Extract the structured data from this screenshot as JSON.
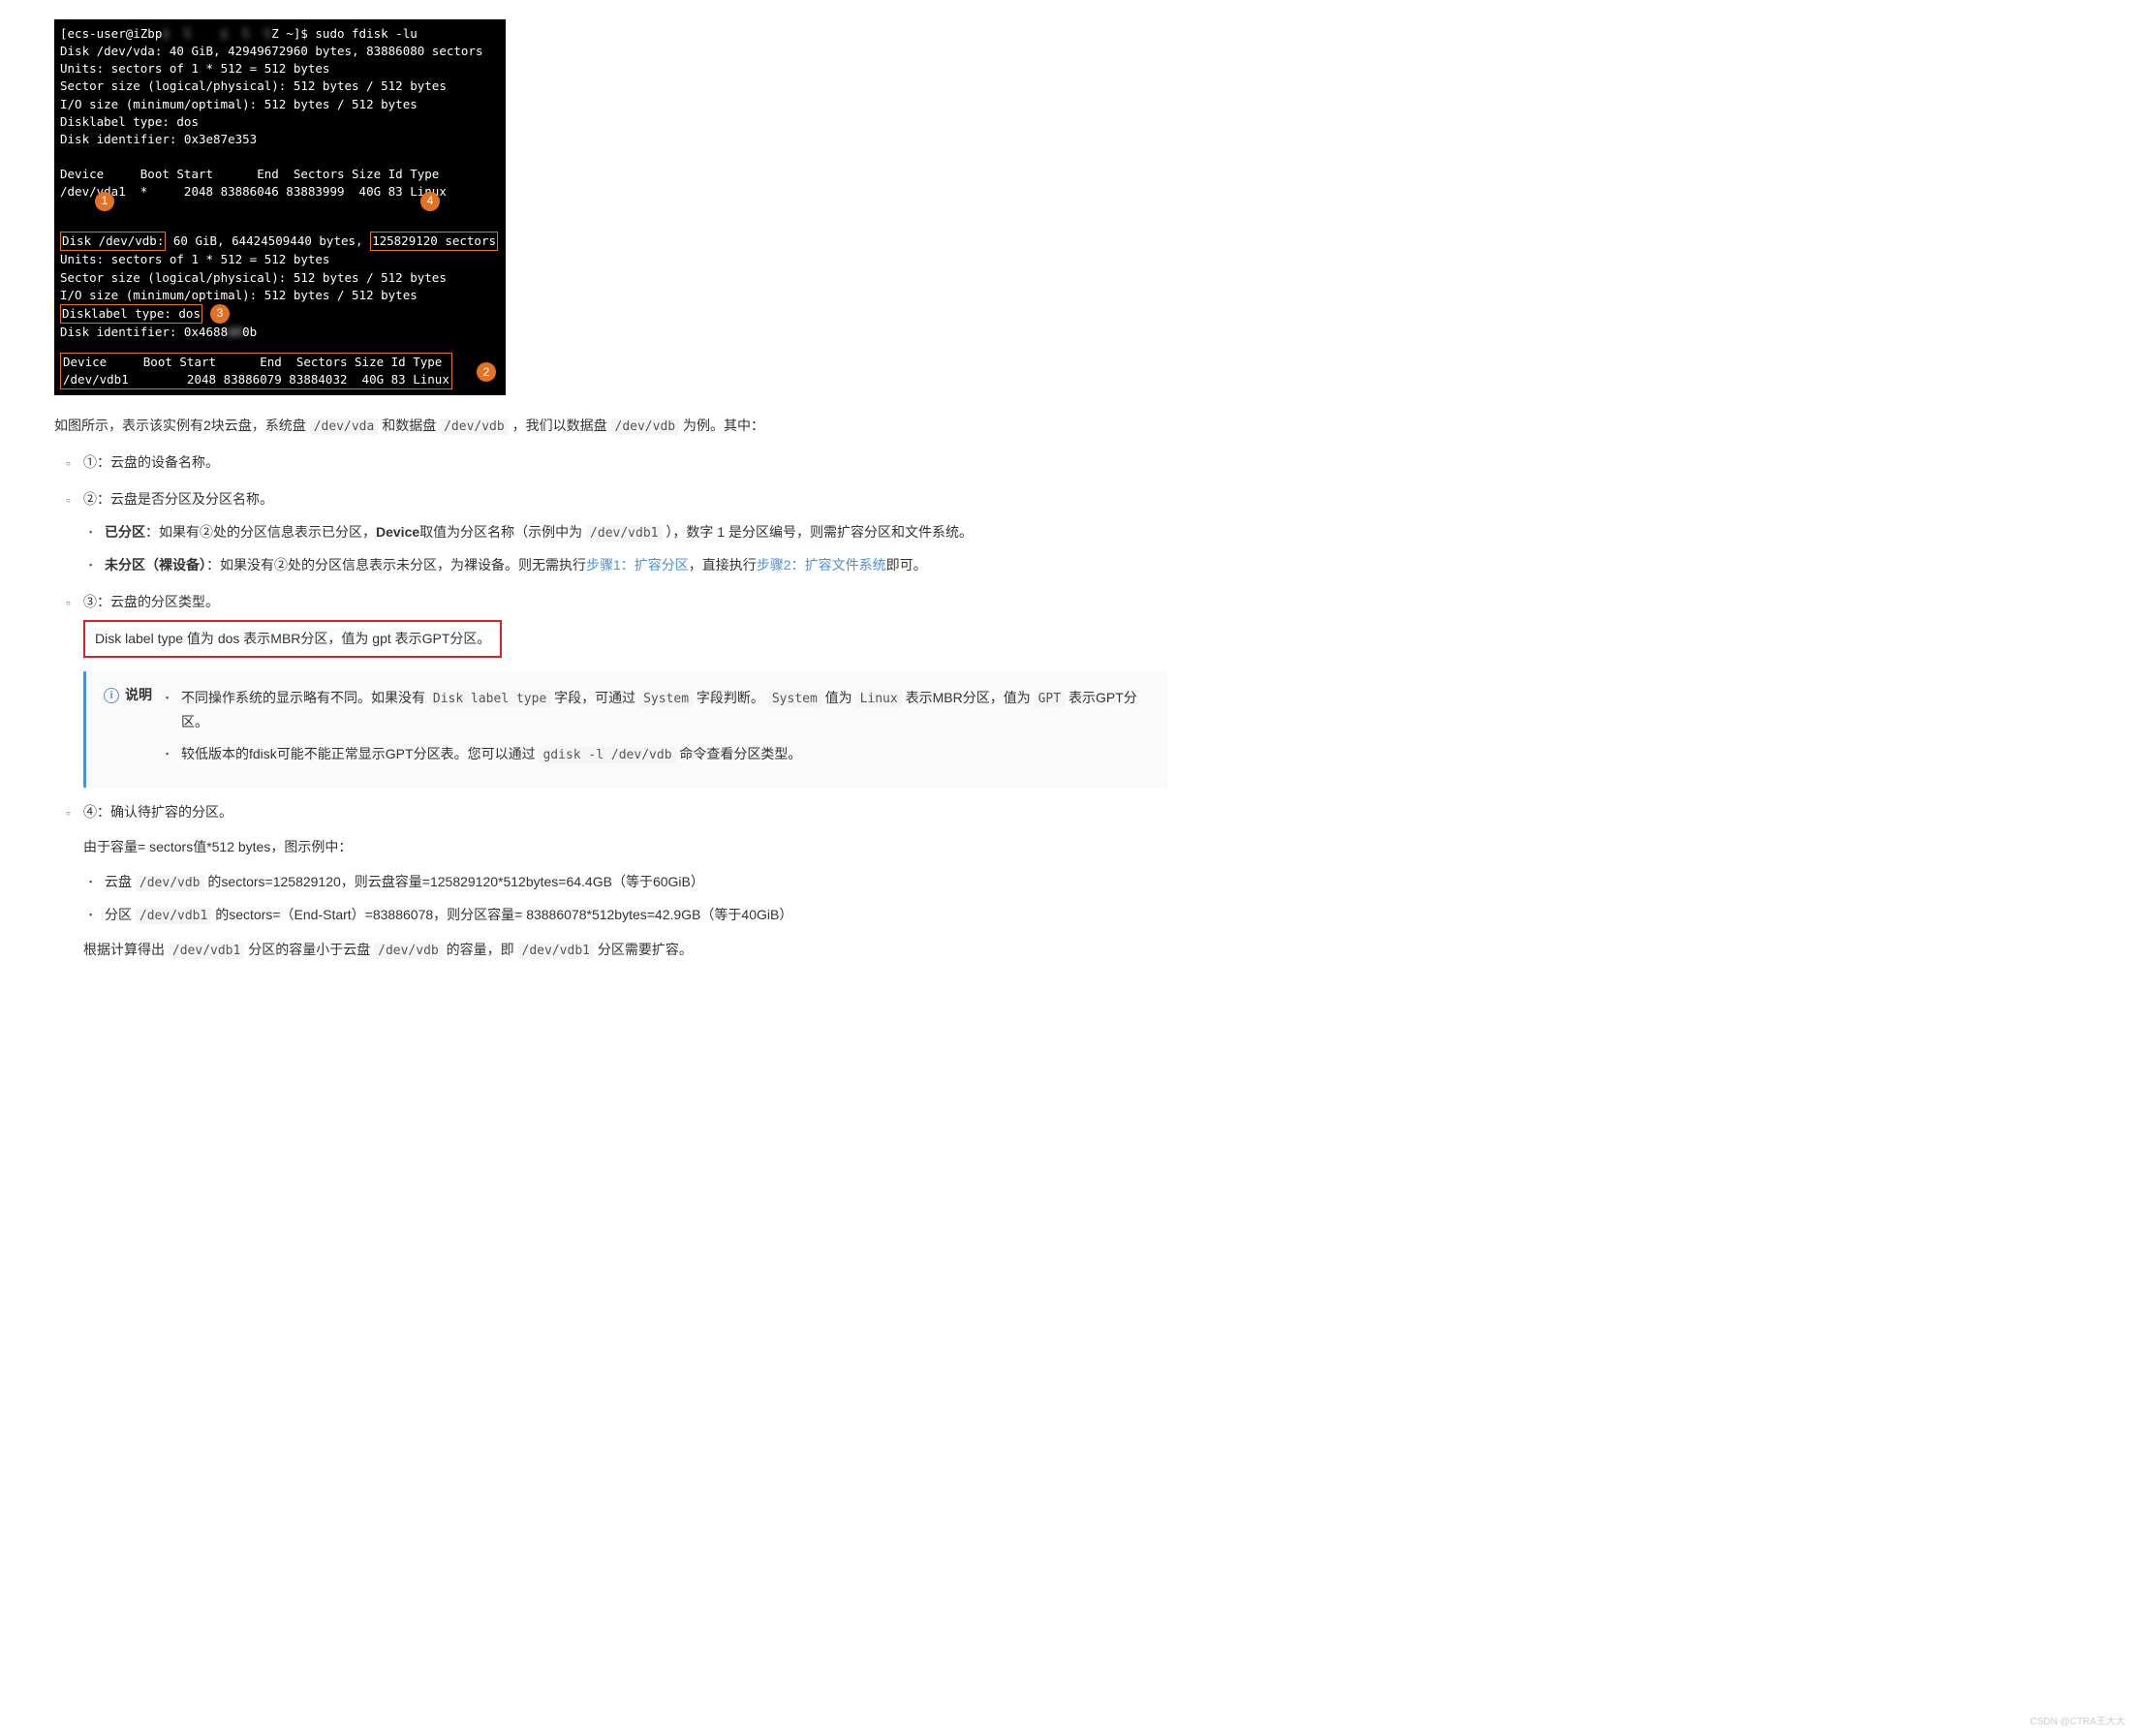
{
  "terminal": {
    "prompt_user": "[ecs-user@iZbp",
    "prompt_blur": "i  l    i  l  l",
    "prompt_tail": "Z ~]$ sudo fdisk -lu",
    "vda_line1": "Disk /dev/vda: 40 GiB, 42949672960 bytes, 83886080 sectors",
    "units": "Units: sectors of 1 * 512 = 512 bytes",
    "sector": "Sector size (logical/physical): 512 bytes / 512 bytes",
    "io": "I/O size (minimum/optimal): 512 bytes / 512 bytes",
    "disklabel": "Disklabel type: dos",
    "diskid_a": "Disk identifier: 0x3e87e353",
    "dev_header": "Device     Boot Start      End  Sectors Size Id Type",
    "vda1_row": "/dev/vda1  *     2048 83886046 83883999  40G 83 Linux",
    "vdb_left": "Disk /dev/vdb:",
    "vdb_mid": " 60 GiB, 64424509440 bytes, ",
    "vdb_right": "125829120 sectors",
    "disklabel2": "Disklabel type: dos",
    "diskid_b_pre": "Disk identifier: 0x4688",
    "diskid_b_blur": "b9",
    "diskid_b_post": "0b",
    "dev_header2": "Device     Boot Start      End  Sectors Size Id Type",
    "vdb1_row": "/dev/vdb1        2048 83886079 83884032  40G 83 Linux",
    "badges": {
      "b1": "1",
      "b2": "2",
      "b3": "3",
      "b4": "4"
    }
  },
  "intro": {
    "pre": "如图所示，表示该实例有2块云盘，系统盘 ",
    "code1": "/dev/vda",
    "mid1": " 和数据盘 ",
    "code2": "/dev/vdb",
    "mid2": " ，我们以数据盘 ",
    "code3": "/dev/vdb",
    "tail": " 为例。其中："
  },
  "item1": "①：云盘的设备名称。",
  "item2": {
    "head": "②：云盘是否分区及分区名称。",
    "a_bold": "已分区",
    "a_text1": "：如果有②处的分区信息表示已分区，",
    "a_bold2": "Device",
    "a_text2": "取值为分区名称（示例中为 ",
    "a_code": "/dev/vdb1",
    "a_text3": " ），数字 1 是分区编号，则需扩容分区和文件系统。",
    "b_bold": "未分区（裸设备）",
    "b_text1": "：如果没有②处的分区信息表示未分区，为裸设备。则无需执行",
    "b_link1": "步骤1：扩容分区",
    "b_text2": "，直接执行",
    "b_link2": "步骤2：扩容文件系统",
    "b_text3": "即可。"
  },
  "item3": {
    "head": "③：云盘的分区类型。",
    "redbox": "Disk label type 值为 dos 表示MBR分区，值为 gpt 表示GPT分区。",
    "info_title": "说明",
    "n1_pre": "不同操作系统的显示略有不同。如果没有 ",
    "n1_c1": "Disk label type",
    "n1_mid1": " 字段，可通过 ",
    "n1_c2": "System",
    "n1_mid2": " 字段判断。 ",
    "n1_c3": "System",
    "n1_mid3": " 值为 ",
    "n1_c4": "Linux",
    "n1_mid4": " 表示MBR分区，值为 ",
    "n1_c5": "GPT",
    "n1_tail": " 表示GPT分区。",
    "n2_pre": "较低版本的fdisk可能不能正常显示GPT分区表。您可以通过 ",
    "n2_code": "gdisk -l /dev/vdb",
    "n2_tail": " 命令查看分区类型。"
  },
  "item4": {
    "head": "④：确认待扩容的分区。",
    "sub": "由于容量= sectors值*512 bytes，图示例中：",
    "u1_pre": "云盘 ",
    "u1_code": "/dev/vdb",
    "u1_tail": " 的sectors=125829120，则云盘容量=125829120*512bytes=64.4GB（等于60GiB）",
    "u2_pre": "分区 ",
    "u2_code": "/dev/vdb1",
    "u2_tail": " 的sectors=（End-Start）=83886078，则分区容量= 83886078*512bytes=42.9GB（等于40GiB）",
    "concl_pre": "根据计算得出 ",
    "concl_c1": "/dev/vdb1",
    "concl_mid1": " 分区的容量小于云盘 ",
    "concl_c2": "/dev/vdb",
    "concl_mid2": " 的容量，即 ",
    "concl_c3": "/dev/vdb1",
    "concl_tail": " 分区需要扩容。"
  },
  "watermark": "CSDN @CTRA王大大"
}
